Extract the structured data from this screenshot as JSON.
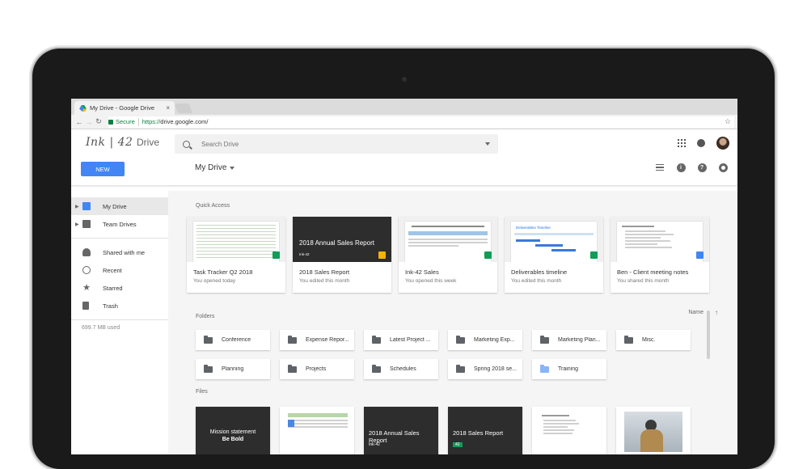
{
  "browser": {
    "tab_title": "My Drive - Google Drive",
    "tab_close": "×",
    "secure_label": "Secure",
    "url_scheme": "https://",
    "url_rest": "drive.google.com/"
  },
  "header": {
    "logo_text": "Ink | 42",
    "product_name": "Drive",
    "search_placeholder": "Search Drive"
  },
  "toolbar": {
    "new_label": "NEW",
    "location": "My Drive"
  },
  "sidebar": {
    "items": [
      {
        "label": "My Drive",
        "icon": "drive-icon"
      },
      {
        "label": "Team Drives",
        "icon": "team-drives-icon"
      },
      {
        "label": "Shared with me",
        "icon": "people-icon"
      },
      {
        "label": "Recent",
        "icon": "clock-icon"
      },
      {
        "label": "Starred",
        "icon": "star-icon"
      },
      {
        "label": "Trash",
        "icon": "trash-icon"
      }
    ],
    "storage": "699.7 MB used"
  },
  "quick_access": {
    "label": "Quick Access",
    "cards": [
      {
        "name": "Task Tracker Q2 2018",
        "meta": "You opened today",
        "type": "sheet"
      },
      {
        "name": "2018 Sales Report",
        "meta": "You edited this month",
        "type": "slide",
        "thumb_title": "2018 Annual Sales Report",
        "thumb_sub": "Ink-42"
      },
      {
        "name": "Ink-42 Sales",
        "meta": "You opened this week",
        "type": "sheet"
      },
      {
        "name": "Deliverables timeline",
        "meta": "You edited this month",
        "type": "sheet",
        "thumb_title": "Deliverables Timeline"
      },
      {
        "name": "Ben - Client meeting notes",
        "meta": "You shared this month",
        "type": "doc"
      }
    ]
  },
  "folders": {
    "label": "Folders",
    "sort_label": "Name",
    "items": [
      {
        "name": "Conference"
      },
      {
        "name": "Expense Repor..."
      },
      {
        "name": "Latest Project ..."
      },
      {
        "name": "Marketing Exp..."
      },
      {
        "name": "Marketing Plan..."
      },
      {
        "name": "Misc."
      },
      {
        "name": "Planning"
      },
      {
        "name": "Projects"
      },
      {
        "name": "Schedules"
      },
      {
        "name": "Spring 2018 se..."
      },
      {
        "name": "Training"
      }
    ]
  },
  "files": {
    "label": "Files",
    "thumbs": [
      {
        "line1": "Mission statement",
        "line2": "Be Bold"
      },
      {},
      {
        "title": "2018 Annual Sales Report",
        "sub": "Ink-42"
      },
      {
        "title": "2018 Sales Report",
        "sub": "42"
      },
      {},
      {}
    ]
  }
}
